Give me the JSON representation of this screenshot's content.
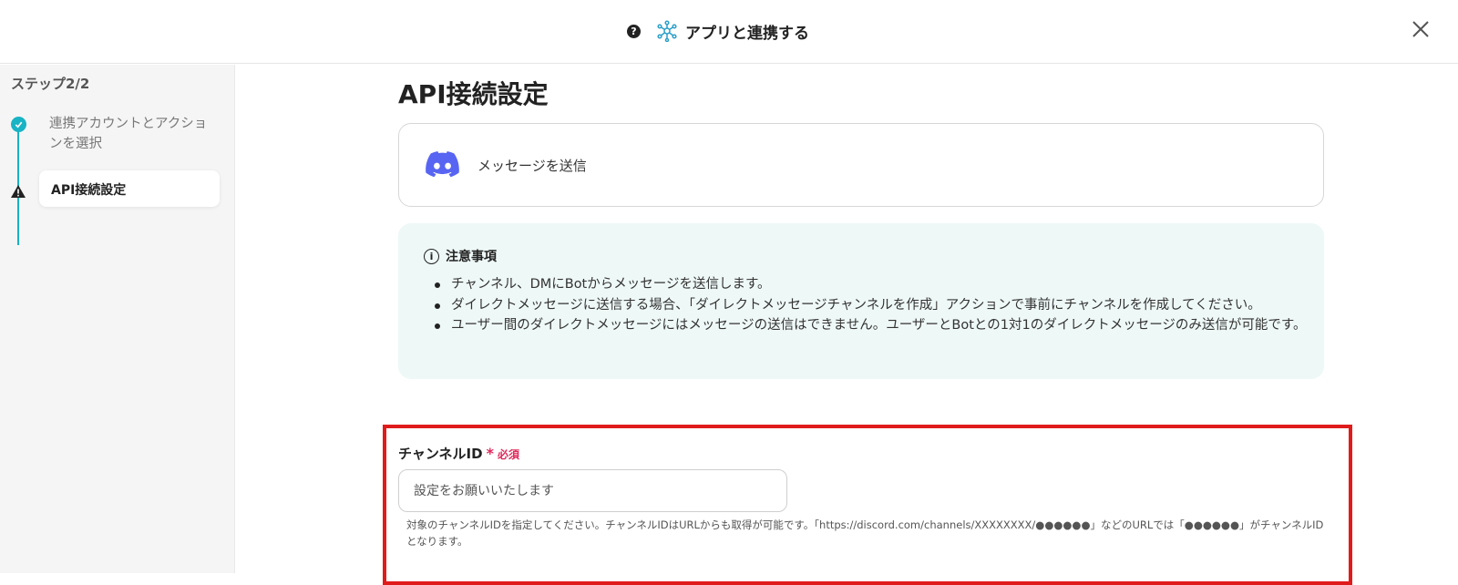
{
  "header": {
    "help_icon": "question-circle-icon",
    "app_icon": "integration-hub-icon",
    "title": "アプリと連携する",
    "close_icon": "close-icon"
  },
  "sidebar": {
    "step_counter": "ステップ2/2",
    "steps": [
      {
        "label": "連携アカウントとアクションを選択",
        "status": "completed",
        "icon": "check-circle-icon"
      },
      {
        "label": "API接続設定",
        "status": "warning",
        "icon": "warning-triangle-icon"
      }
    ]
  },
  "main": {
    "title": "API接続設定",
    "action": {
      "icon": "discord-icon",
      "label": "メッセージを送信"
    },
    "notice": {
      "icon": "info-circle-icon",
      "title": "注意事項",
      "items": [
        "チャンネル、DMにBotからメッセージを送信します。",
        "ダイレクトメッセージに送信する場合、「ダイレクトメッセージチャンネルを作成」アクションで事前にチャンネルを作成してください。",
        "ユーザー間のダイレクトメッセージにはメッセージの送信はできません。ユーザーとBotとの1対1のダイレクトメッセージのみ送信が可能です。"
      ]
    },
    "channel_field": {
      "label": "チャンネルID",
      "required_mark": "*",
      "required_text": "必須",
      "value": "",
      "placeholder": "設定をお願いいたします",
      "help": "対象のチャンネルIDを指定してください。チャンネルIDはURLからも取得が可能です。「https://discord.com/channels/XXXXXXXX/●●●●●●」などのURLでは「●●●●●●」がチャンネルIDとなります。"
    }
  },
  "colors": {
    "accent": "#18b3c4",
    "notice_bg": "#eef8f7",
    "required": "#e0285b",
    "highlight": "#e01b1b",
    "discord": "#5865f2"
  }
}
